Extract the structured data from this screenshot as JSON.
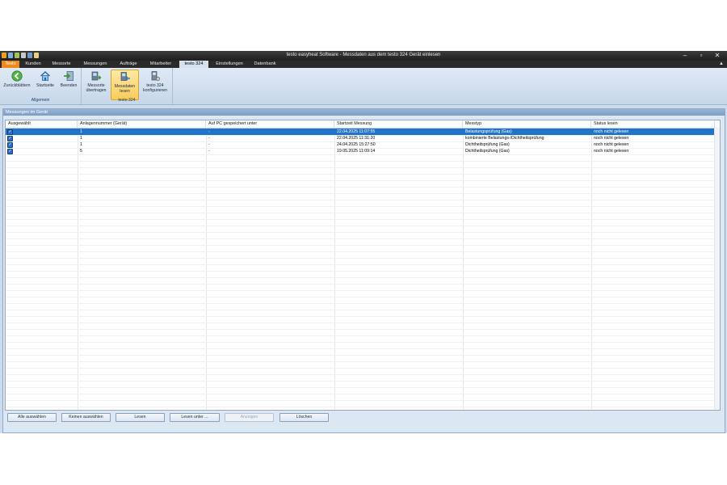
{
  "window": {
    "title": "testo easyheat Software - Messdaten aus dem testo 324 Gerät einlesen",
    "controls": [
      "–",
      "▫",
      "✕"
    ]
  },
  "menu": {
    "app_tab": "Testo",
    "tabs": [
      "Kunden",
      "Messorte",
      "Messungen",
      "Aufträge",
      "Mitarbeiter",
      "testo 324",
      "Einstellungen",
      "Datenbank"
    ],
    "active_tab": "testo 324"
  },
  "ribbon": {
    "groups": [
      {
        "label": "Allgemein",
        "buttons": [
          {
            "label": "Zurückblättern",
            "icon": "back-arrow-icon"
          },
          {
            "label": "Startseite",
            "icon": "home-icon"
          },
          {
            "label": "Beenden",
            "icon": "exit-icon"
          }
        ]
      },
      {
        "label": "testo 324",
        "buttons": [
          {
            "label": "Messorte\nübertragen",
            "icon": "transfer-icon"
          },
          {
            "label": "Messdaten\nlesen",
            "icon": "read-data-icon",
            "pressed": true
          },
          {
            "label": "testo 324\nkonfigurieren",
            "icon": "configure-device-icon"
          }
        ]
      }
    ]
  },
  "panel": {
    "title": "Messungen im Gerät"
  },
  "table": {
    "columns": [
      "Ausgewählt",
      "Anlagennummer (Gerät)",
      "Auf PC gespeichert unter",
      "Startzeit Messung",
      "Messtyp",
      "Status lesen"
    ],
    "rows": [
      {
        "selected": true,
        "anlage": "1",
        "gespeichert": "-",
        "startzeit": "22.04.2025 11:07:55",
        "messtyp": "Belastungsprüfung (Gas)",
        "status": "noch nicht gelesen"
      },
      {
        "selected": true,
        "anlage": "1",
        "gespeichert": "-",
        "startzeit": "22.04.2025 11:31:20",
        "messtyp": "kombinierte Belastungs-/Dichtheitsprüfung",
        "status": "noch nicht gelesen"
      },
      {
        "selected": true,
        "anlage": "1",
        "gespeichert": "-",
        "startzeit": "24.04.2025 15:27:50",
        "messtyp": "Dichtheitsprüfung (Gas)",
        "status": "noch nicht gelesen"
      },
      {
        "selected": true,
        "anlage": "5",
        "gespeichert": "-",
        "startzeit": "19.05.2025 11:09:14",
        "messtyp": "Dichtheitsprüfung (Gas)",
        "status": "noch nicht gelesen"
      }
    ],
    "highlighted_row": 0
  },
  "buttons": {
    "select_all": "Alle auswählen",
    "select_none": "Keinen auswählen",
    "read": "Lesen",
    "read_as": "Lesen unter ...",
    "show": "Anzeigen",
    "delete": "Löschen"
  },
  "colors": {
    "accent": "#ec8a1c",
    "selection": "#1f73c8",
    "panel": "#dbe7f3"
  }
}
